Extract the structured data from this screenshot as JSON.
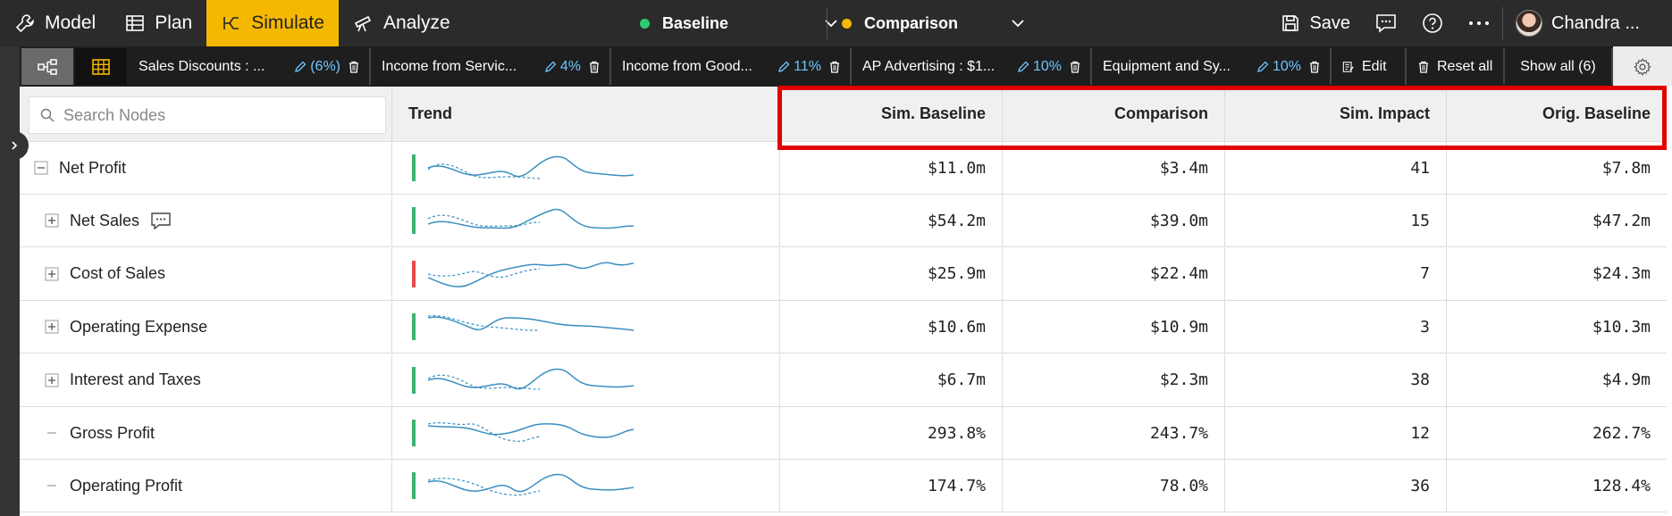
{
  "nav": {
    "model": "Model",
    "plan": "Plan",
    "simulate": "Simulate",
    "analyze": "Analyze"
  },
  "scenarios": {
    "baseline": {
      "label": "Baseline",
      "color": "#2ecc71"
    },
    "comparison": {
      "label": "Comparison",
      "color": "#f5b800"
    }
  },
  "tools": {
    "save": "Save",
    "user": "Chandra ..."
  },
  "filters": [
    {
      "name": "Sales Discounts : ...",
      "value": "(6%)"
    },
    {
      "name": "Income from Servic...",
      "value": "4%"
    },
    {
      "name": "Income from Good...",
      "value": "11%"
    },
    {
      "name": "AP Advertising : $1...",
      "value": "10%"
    },
    {
      "name": "Equipment and Sy...",
      "value": "10%"
    }
  ],
  "actions": {
    "edit": "Edit",
    "reset_all": "Reset all",
    "show_all": "Show all (6)"
  },
  "search": {
    "placeholder": "Search Nodes"
  },
  "columns": {
    "trend": "Trend",
    "sim_baseline": "Sim. Baseline",
    "comparison": "Comparison",
    "sim_impact": "Sim. Impact",
    "orig_baseline": "Orig. Baseline"
  },
  "rows": [
    {
      "name": "Net Profit",
      "expander": "minus",
      "status": "#3cb371",
      "sim_baseline": "$11.0m",
      "comparison": "$3.4m",
      "sim_impact": "41",
      "orig_baseline": "$7.8m"
    },
    {
      "name": "Net Sales",
      "expander": "plus",
      "status": "#3cb371",
      "comment": true,
      "sim_baseline": "$54.2m",
      "comparison": "$39.0m",
      "sim_impact": "15",
      "orig_baseline": "$47.2m"
    },
    {
      "name": "Cost of Sales",
      "expander": "plus",
      "status": "#e84b4b",
      "sim_baseline": "$25.9m",
      "comparison": "$22.4m",
      "sim_impact": "7",
      "orig_baseline": "$24.3m"
    },
    {
      "name": "Operating Expense",
      "expander": "plus",
      "status": "#3cb371",
      "sim_baseline": "$10.6m",
      "comparison": "$10.9m",
      "sim_impact": "3",
      "orig_baseline": "$10.3m"
    },
    {
      "name": "Interest and Taxes",
      "expander": "plus",
      "status": "#3cb371",
      "sim_baseline": "$6.7m",
      "comparison": "$2.3m",
      "sim_impact": "38",
      "orig_baseline": "$4.9m"
    },
    {
      "name": "Gross Profit",
      "expander": "dash",
      "status": "#3cb371",
      "sim_baseline": "293.8%",
      "comparison": "243.7%",
      "sim_impact": "12",
      "orig_baseline": "262.7%"
    },
    {
      "name": "Operating Profit",
      "expander": "dash",
      "status": "#3cb371",
      "sim_baseline": "174.7%",
      "comparison": "78.0%",
      "sim_impact": "36",
      "orig_baseline": "128.4%"
    }
  ]
}
